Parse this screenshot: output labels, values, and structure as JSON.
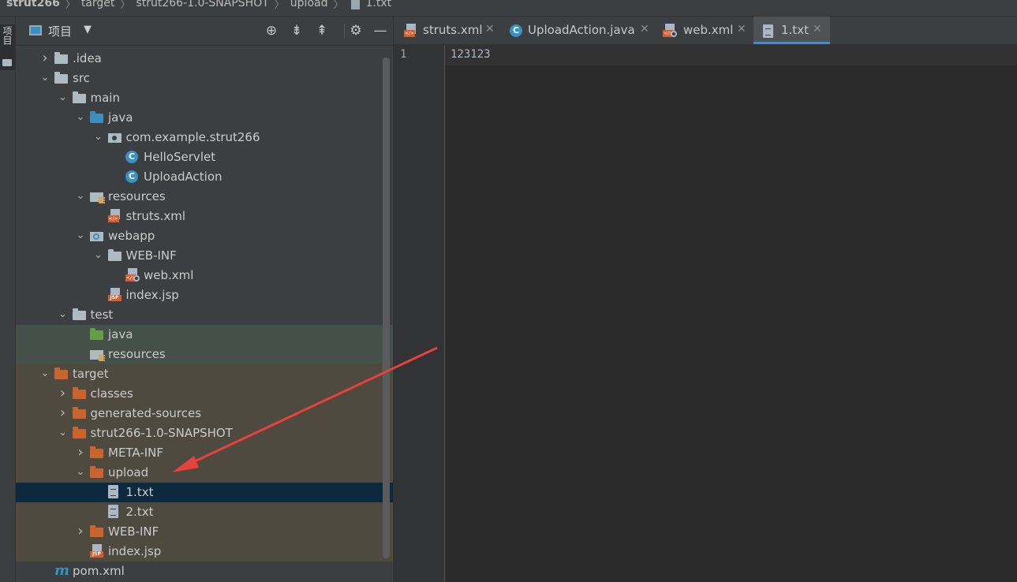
{
  "breadcrumb": [
    "strut266",
    "target",
    "strut266-1.0-SNAPSHOT",
    "upload",
    "1.txt"
  ],
  "left_stripe": {
    "project_label": "项目"
  },
  "project_panel": {
    "title": "项目",
    "header_icons": [
      "locate-icon",
      "expand-all-icon",
      "collapse-all-icon",
      "gear-icon",
      "minimize-icon"
    ]
  },
  "tree": [
    {
      "label": ".idea",
      "expanded": false,
      "icon": "folder-gray",
      "level": 1
    },
    {
      "label": "src",
      "expanded": true,
      "icon": "folder-gray",
      "level": 1
    },
    {
      "label": "main",
      "expanded": true,
      "icon": "folder-gray",
      "level": 2
    },
    {
      "label": "java",
      "expanded": true,
      "icon": "folder-blue",
      "level": 3
    },
    {
      "label": "com.example.strut266",
      "expanded": true,
      "icon": "package",
      "level": 4
    },
    {
      "label": "HelloServlet",
      "icon": "java-class",
      "level": 5
    },
    {
      "label": "UploadAction",
      "icon": "java-class",
      "level": 5
    },
    {
      "label": "resources",
      "expanded": true,
      "icon": "resources",
      "level": 3
    },
    {
      "label": "struts.xml",
      "icon": "xml-file",
      "level": 4
    },
    {
      "label": "webapp",
      "expanded": true,
      "icon": "webapp",
      "level": 3
    },
    {
      "label": "WEB-INF",
      "expanded": true,
      "icon": "folder-gray",
      "level": 4
    },
    {
      "label": "web.xml",
      "icon": "webxml-file",
      "level": 5
    },
    {
      "label": "index.jsp",
      "icon": "jsp-file",
      "level": 4
    },
    {
      "label": "test",
      "expanded": true,
      "icon": "folder-gray",
      "level": 2
    },
    {
      "label": "java",
      "icon": "folder-green",
      "level": 3
    },
    {
      "label": "resources",
      "icon": "resources-test",
      "level": 3
    },
    {
      "label": "target",
      "expanded": true,
      "icon": "folder-orange",
      "level": 1
    },
    {
      "label": "classes",
      "expanded": false,
      "icon": "folder-orange",
      "level": 2
    },
    {
      "label": "generated-sources",
      "expanded": false,
      "icon": "folder-orange",
      "level": 2
    },
    {
      "label": "strut266-1.0-SNAPSHOT",
      "expanded": true,
      "icon": "folder-orange",
      "level": 2
    },
    {
      "label": "META-INF",
      "expanded": false,
      "icon": "folder-orange",
      "level": 3
    },
    {
      "label": "upload",
      "expanded": true,
      "icon": "folder-orange",
      "level": 3
    },
    {
      "label": "1.txt",
      "icon": "text-file",
      "level": 4,
      "selected": true
    },
    {
      "label": "2.txt",
      "icon": "text-file",
      "level": 4
    },
    {
      "label": "WEB-INF",
      "expanded": false,
      "icon": "folder-orange",
      "level": 3
    },
    {
      "label": "index.jsp",
      "icon": "jsp-file",
      "level": 3
    },
    {
      "label": "pom.xml",
      "icon": "maven-file",
      "level": 1
    }
  ],
  "editor": {
    "tabs": [
      {
        "label": "struts.xml",
        "icon": "xml-file",
        "active": false
      },
      {
        "label": "UploadAction.java",
        "icon": "java-class",
        "active": false
      },
      {
        "label": "web.xml",
        "icon": "webxml-file",
        "active": false
      },
      {
        "label": "1.txt",
        "icon": "text-file",
        "active": true
      }
    ],
    "line_numbers": [
      "1"
    ],
    "lines": [
      "123123"
    ]
  },
  "colors": {
    "accent": "#4a88c7",
    "selection": "#0d293e",
    "test_bg": "#45504a",
    "excluded_bg": "#4f4a3f",
    "annotation_arrow": "#e8413b"
  }
}
